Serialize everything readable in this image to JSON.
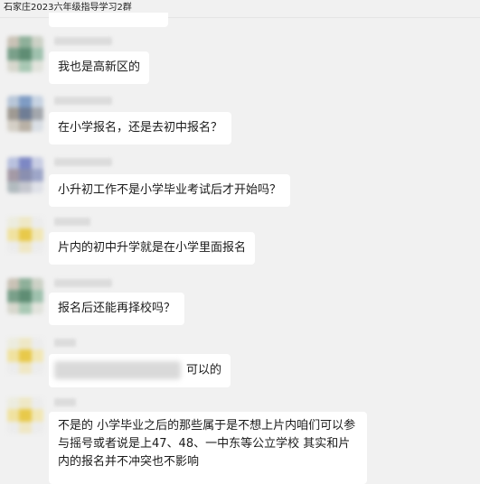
{
  "window": {
    "title": "石家庄2023六年级指导学习2群"
  },
  "messages": [
    {
      "text": "我也是高新区的"
    },
    {
      "text": "在小学报名，还是去初中报名？"
    },
    {
      "text": "小升初工作不是小学毕业考试后才开始吗？"
    },
    {
      "text": "片内的初中升学就是在小学里面报名"
    },
    {
      "text": "报名后还能再择校吗？"
    },
    {
      "text": "可以的"
    },
    {
      "text": "不是的  小学毕业之后的那些属于是不想上片内咱们可以参与摇号或者说是上47、48、一中东等公立学校 其实和片内的报名并不冲突也不影响"
    }
  ],
  "colors": {
    "background": "#f1f1f1",
    "bubble": "#ffffff",
    "text": "#1a1a1a"
  }
}
